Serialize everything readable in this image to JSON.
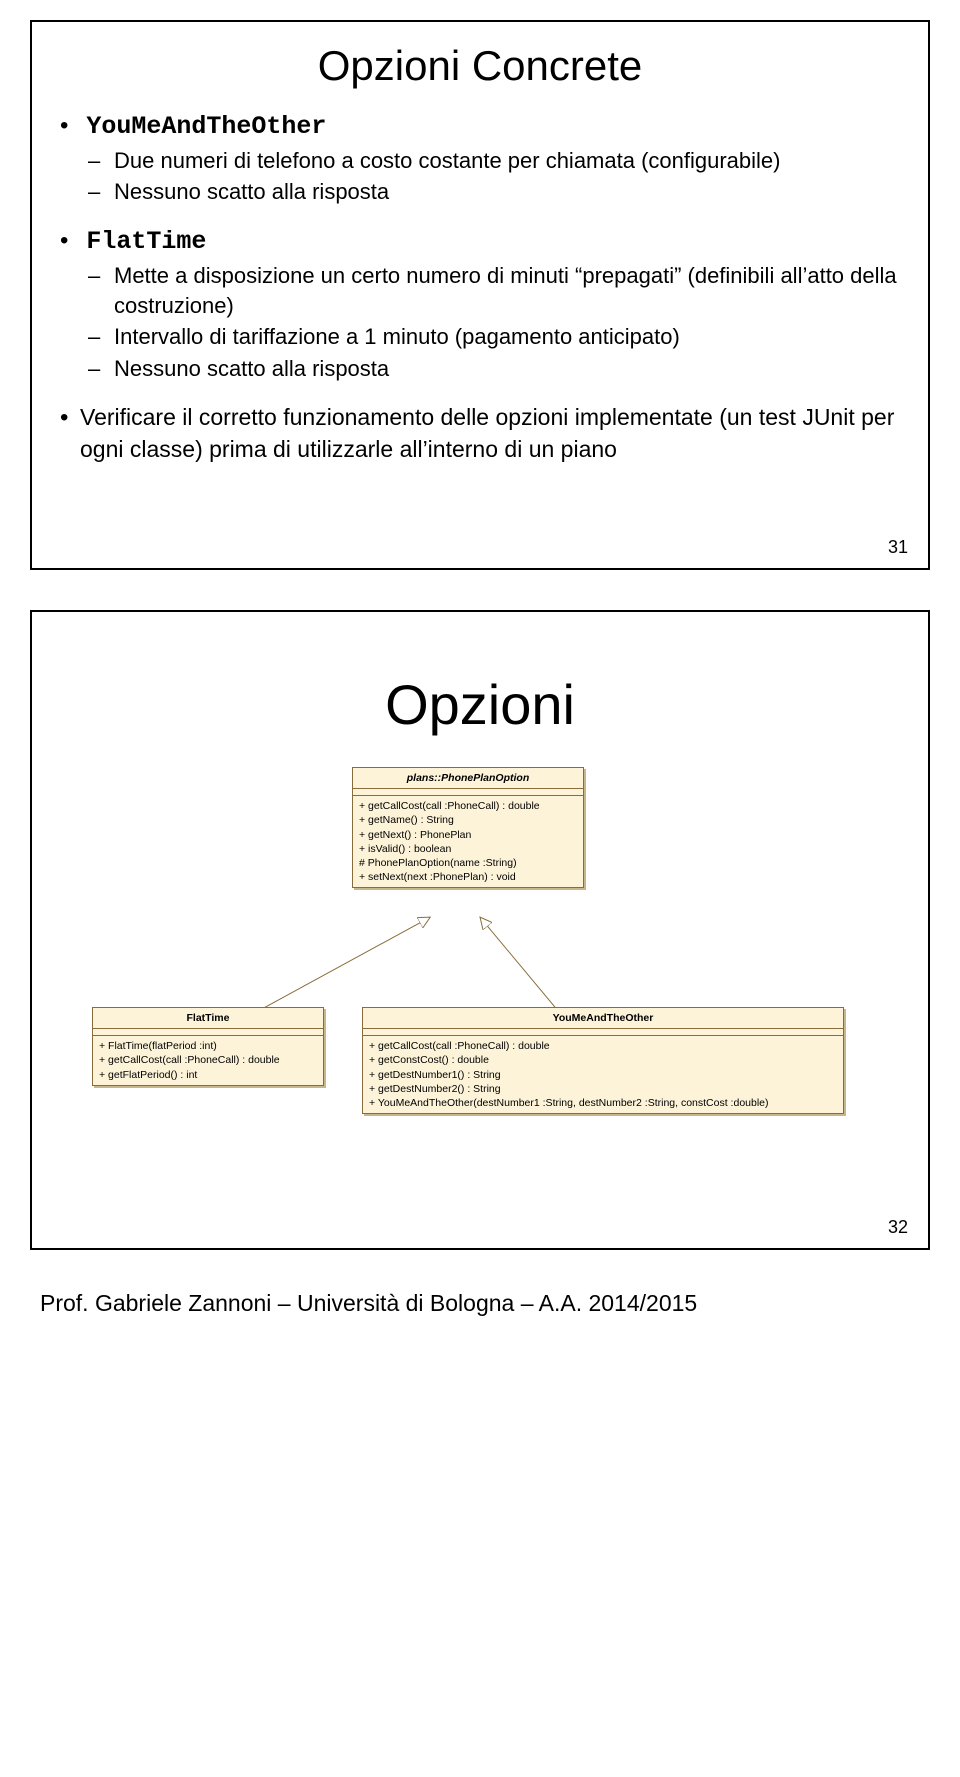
{
  "slide1": {
    "title": "Opzioni Concrete",
    "bullet1_code": "YouMeAndTheOther",
    "bullet1_sub1": "Due numeri di telefono a costo costante per chiamata (configurabile)",
    "bullet1_sub2": "Nessuno scatto alla risposta",
    "bullet2_code": "FlatTime",
    "bullet2_sub1": "Mette a disposizione un certo numero di minuti “prepagati” (definibili all’atto della costruzione)",
    "bullet2_sub2": "Intervallo di tariffazione a 1 minuto (pagamento anticipato)",
    "bullet2_sub3": "Nessuno scatto alla risposta",
    "bullet3": "Verificare il corretto funzionamento delle opzioni implementate (un test JUnit per ogni classe) prima di utilizzarle all’interno di un piano",
    "page": "31"
  },
  "slide2": {
    "title": "Opzioni",
    "page": "32",
    "uml": {
      "parent": {
        "name": "plans::PhonePlanOption",
        "m1": "+    getCallCost(call :PhoneCall) : double",
        "m2": "+    getName() : String",
        "m3": "+    getNext() : PhonePlan",
        "m4": "+    isValid() : boolean",
        "m5": "#    PhonePlanOption(name :String)",
        "m6": "+    setNext(next :PhonePlan) : void"
      },
      "flattime": {
        "name": "FlatTime",
        "m1": "+    FlatTime(flatPeriod :int)",
        "m2": "+    getCallCost(call :PhoneCall) : double",
        "m3": "+    getFlatPeriod() : int"
      },
      "youme": {
        "name": "YouMeAndTheOther",
        "m1": "+    getCallCost(call :PhoneCall) : double",
        "m2": "+    getConstCost() : double",
        "m3": "+    getDestNumber1() : String",
        "m4": "+    getDestNumber2() : String",
        "m5": "+    YouMeAndTheOther(destNumber1 :String, destNumber2 :String, constCost :double)"
      }
    }
  },
  "footer": "Prof. Gabriele Zannoni – Università di Bologna – A.A. 2014/2015"
}
